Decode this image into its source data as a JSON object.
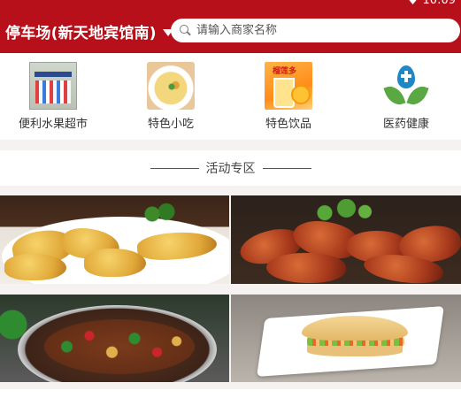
{
  "status_bar": {
    "time": "10:09"
  },
  "header": {
    "location": "停车场(新天地宾馆南)",
    "search_placeholder": "请输入商家名称"
  },
  "categories": [
    {
      "label": "便利水果超市",
      "icon": "convenience-store-icon"
    },
    {
      "label": "特色小吃",
      "icon": "snack-dish-icon"
    },
    {
      "label": "特色饮品",
      "icon": "drink-icon",
      "badge": "榴莲多"
    },
    {
      "label": "医药健康",
      "icon": "medical-drop-icon"
    }
  ],
  "section": {
    "title": "活动专区"
  },
  "promos": [
    {
      "image": "fried-chicken-image"
    },
    {
      "image": "spicy-shrimp-image"
    },
    {
      "image": "stir-fry-pan-image"
    },
    {
      "image": "chinese-burger-image"
    }
  ],
  "colors": {
    "brand": "#b8101a",
    "background": "#f7f2f2"
  }
}
